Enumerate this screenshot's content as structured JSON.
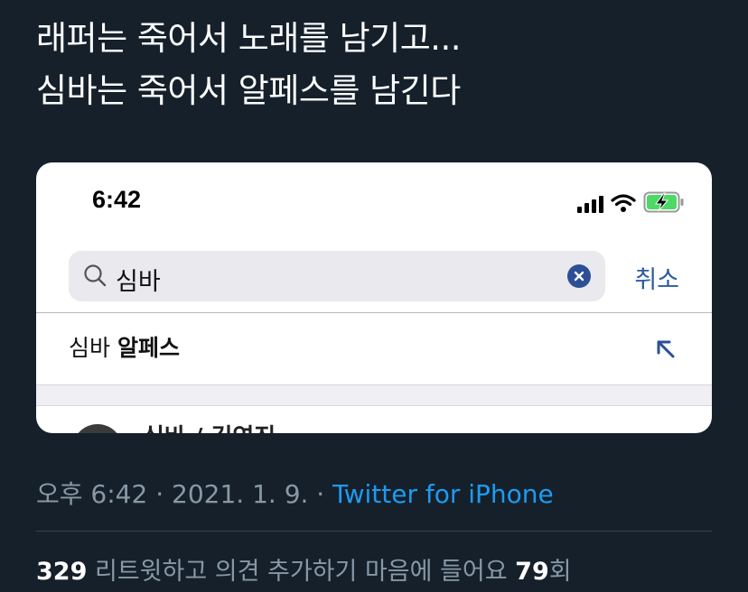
{
  "tweet": {
    "line1": "래퍼는 죽어서 노래를 남기고...",
    "line2": "심바는 죽어서 알페스를 남긴다"
  },
  "screenshot": {
    "status_time": "6:42",
    "search_value": "심바",
    "cancel_label": "취소",
    "suggestion_prefix": "심바 ",
    "suggestion_bold": "알페스",
    "result_name": "심바 / 김연진",
    "icons": [
      "signal-icon",
      "wifi-icon",
      "battery-icon",
      "search-icon",
      "clear-icon",
      "suggestion-arrow-icon"
    ],
    "colors": {
      "accent": "#2c5aa0",
      "search_bg": "#e9e9ee",
      "battery": "#4cd964"
    }
  },
  "meta": {
    "time": "오후 6:42",
    "sep1": " · ",
    "date": "2021. 1. 9.",
    "sep2": " · ",
    "source": "Twitter for iPhone"
  },
  "stats": {
    "retweets": "329",
    "retweets_label": " 리트윗하고 의견 추가하기",
    "likes_prefix": "  마음에 들어요 ",
    "likes": "79",
    "likes_suffix": "회"
  },
  "colors": {
    "background": "#15202b",
    "link": "#1d9bf0",
    "muted": "#8899a6"
  }
}
